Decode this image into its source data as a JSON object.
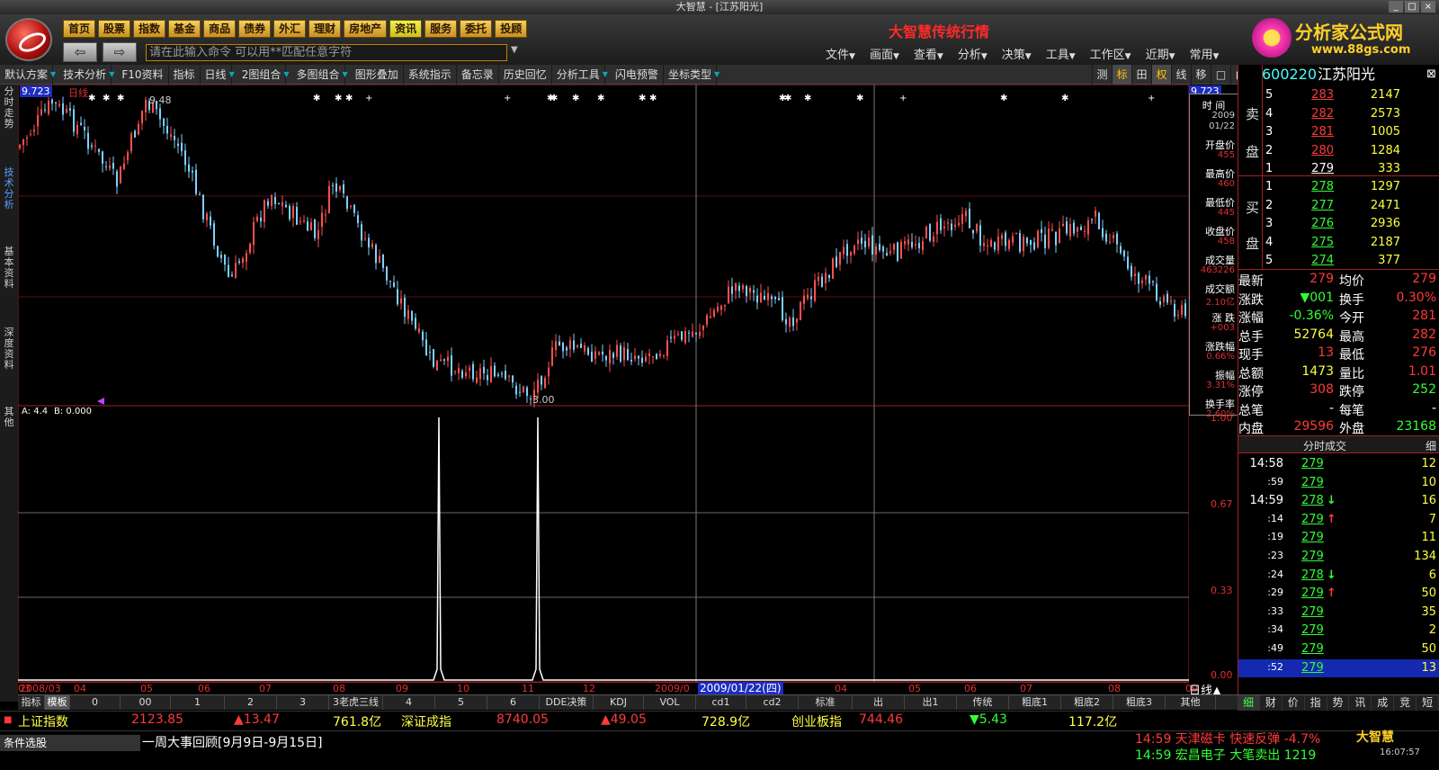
{
  "window": {
    "title": "大智慧 - [江苏阳光]"
  },
  "header": {
    "nav": [
      "首页",
      "股票",
      "指数",
      "基金",
      "商品",
      "债券",
      "外汇",
      "理财",
      "房地产",
      "资讯",
      "服务",
      "委托",
      "投顾"
    ],
    "nav_highlight": "资讯",
    "banner": "大智慧传统行情",
    "brand": "分析家公式网",
    "brand_url": "www.88gs.com",
    "cmd_placeholder": "请在此输入命令    可以用**匹配任意字符",
    "menus": [
      "文件",
      "画面",
      "查看",
      "分析",
      "决策",
      "工具",
      "工作区",
      "近期",
      "常用"
    ]
  },
  "toolbar": {
    "items": [
      {
        "label": "默认方案",
        "dd": true
      },
      {
        "label": "技术分析",
        "dd": true
      },
      {
        "label": "F10资料",
        "dd": false
      },
      {
        "label": "指标",
        "dd": false
      },
      {
        "label": "日线",
        "dd": true
      },
      {
        "label": "2图组合",
        "dd": true
      },
      {
        "label": "多图组合",
        "dd": true
      },
      {
        "label": "图形叠加",
        "dd": false
      },
      {
        "label": "系统指示",
        "dd": false
      },
      {
        "label": "备忘录",
        "dd": false
      },
      {
        "label": "历史回忆",
        "dd": false
      },
      {
        "label": "分析工具",
        "dd": true
      },
      {
        "label": "闪电预警",
        "dd": false
      },
      {
        "label": "坐标类型",
        "dd": true
      }
    ],
    "right": [
      "测",
      "标",
      "田",
      "权",
      "线",
      "移",
      "□",
      "▶"
    ]
  },
  "left_tabs": [
    "分时走势",
    "技术分析",
    "基本资料",
    "深度资料",
    "其他"
  ],
  "chart": {
    "price_label": "9.723",
    "period_label": "日线",
    "high_mark": "9.48",
    "low_mark": "3.00",
    "indicator_label": "A: 4.4",
    "indicator_b": "B: 0.000",
    "yaxis_labels": [
      "1.00",
      "0.67",
      "0.33",
      "0.00"
    ],
    "dates": [
      "2008/03",
      "04",
      "05",
      "06",
      "07",
      "08",
      "09",
      "10",
      "11",
      "12",
      "2009/0",
      "2009/01/22(四)",
      "03",
      "04",
      "05",
      "06",
      "07",
      "08",
      "09"
    ],
    "cursor_date": "2009/01/22(四)",
    "period_btn": "日线▲"
  },
  "infobox": {
    "items": [
      {
        "label": "时 间",
        "value": "2009"
      },
      {
        "label": "",
        "value": "01/22"
      },
      {
        "label": "开盘价",
        "value": "455"
      },
      {
        "label": "最高价",
        "value": "460"
      },
      {
        "label": "最低价",
        "value": "445"
      },
      {
        "label": "收盘价",
        "value": "458"
      },
      {
        "label": "成交量",
        "value": "463226"
      },
      {
        "label": "成交额",
        "value": "2.10亿"
      },
      {
        "label": "涨 跌",
        "value": "+003"
      },
      {
        "label": "涨跌幅",
        "value": "0.66%"
      },
      {
        "label": "振幅",
        "value": "3.31%"
      },
      {
        "label": "换手率",
        "value": "2.60%"
      }
    ]
  },
  "tabs2": [
    "指标",
    "模板",
    "0",
    "00",
    "1",
    "2",
    "3",
    "3老虎三线",
    "4",
    "5",
    "6",
    "DDE决策",
    "KDJ",
    "VOL",
    "cd1",
    "cd2",
    "标准",
    "出",
    "出1",
    "传统",
    "粗底1",
    "粗底2",
    "粗底3",
    "其他"
  ],
  "indices": [
    {
      "name": "上证指数",
      "value": "2123.85",
      "chg": "▲13.47",
      "amt": "761.8亿"
    },
    {
      "name": "深证成指",
      "value": "8740.05",
      "chg": "▲49.05",
      "amt": "728.9亿"
    },
    {
      "name": "创业板指",
      "value": "744.46",
      "chg": "▼5.43",
      "amt": "117.2亿"
    }
  ],
  "news": {
    "left": "条件选股",
    "headline": "一周大事回顾[9月9日-9月15日]",
    "ticker": [
      "14:59 天津磁卡 快速反弹 -4.7%",
      "14:59 宏昌电子 大笔卖出 1219"
    ],
    "logo": "大智慧",
    "clock": "16:07:57"
  },
  "side": {
    "code": "600220",
    "name": "江苏阳光",
    "sell_label": [
      "卖",
      "盘"
    ],
    "buy_label": [
      "买",
      "盘"
    ],
    "sell": [
      [
        "5",
        "283",
        "2147"
      ],
      [
        "4",
        "282",
        "2573"
      ],
      [
        "3",
        "281",
        "1005"
      ],
      [
        "2",
        "280",
        "1284"
      ],
      [
        "1",
        "279",
        "333"
      ]
    ],
    "buy": [
      [
        "1",
        "278",
        "1297"
      ],
      [
        "2",
        "277",
        "2471"
      ],
      [
        "3",
        "276",
        "2936"
      ],
      [
        "4",
        "275",
        "2187"
      ],
      [
        "5",
        "274",
        "377"
      ]
    ],
    "stats": [
      [
        "最新",
        "279",
        "均价",
        "279"
      ],
      [
        "涨跌",
        "▼001",
        "换手",
        "0.30%"
      ],
      [
        "涨幅",
        "-0.36%",
        "今开",
        "281"
      ],
      [
        "总手",
        "52764",
        "最高",
        "282"
      ],
      [
        "现手",
        "13",
        "最低",
        "276"
      ],
      [
        "总额",
        "1473",
        "量比",
        "1.01"
      ],
      [
        "涨停",
        "308",
        "跌停",
        "252"
      ],
      [
        "总笔",
        "-",
        "每笔",
        "-"
      ],
      [
        "内盘",
        "29596",
        "外盘",
        "23168"
      ]
    ],
    "tick_title": "分时成交",
    "tick_tab": "细",
    "ticks": [
      [
        "14:58",
        "279",
        "",
        "12"
      ],
      [
        ":59",
        "279",
        "",
        "10"
      ],
      [
        "14:59",
        "278",
        "↓",
        "16"
      ],
      [
        ":14",
        "279",
        "↑",
        "7"
      ],
      [
        ":19",
        "279",
        "",
        "11"
      ],
      [
        ":23",
        "279",
        "",
        "134"
      ],
      [
        ":24",
        "278",
        "↓",
        "6"
      ],
      [
        ":29",
        "279",
        "↑",
        "50"
      ],
      [
        ":33",
        "279",
        "",
        "35"
      ],
      [
        ":34",
        "279",
        "",
        "2"
      ],
      [
        ":49",
        "279",
        "",
        "50"
      ],
      [
        ":52",
        "279",
        "",
        "13"
      ]
    ],
    "tabs": [
      "细",
      "财",
      "价",
      "指",
      "势",
      "讯",
      "成",
      "竞",
      "短"
    ]
  },
  "colors": {
    "up": "#ff3a3a",
    "down": "#33ff33",
    "grid": "#8b1a1a",
    "candle_down": "#7fd0ff"
  }
}
